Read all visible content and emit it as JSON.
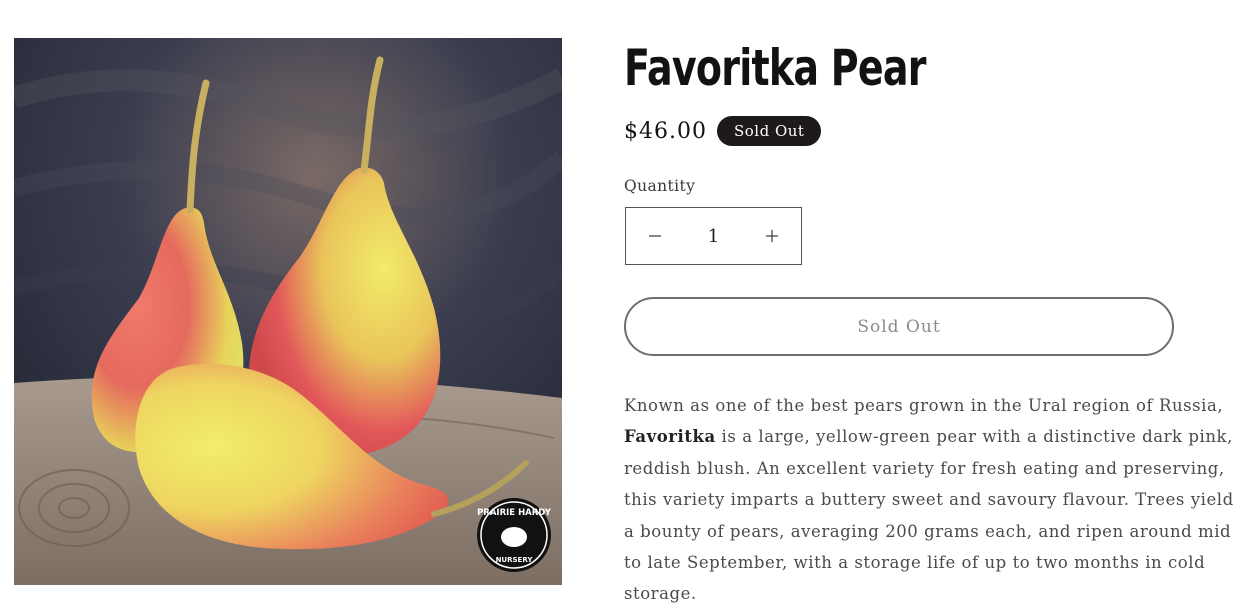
{
  "product": {
    "title": "Favoritka Pear",
    "price": "$46.00",
    "badge": "Sold Out",
    "image_logo_text_top": "PRAIRIE HARDY",
    "image_logo_text_bottom": "NURSERY"
  },
  "quantity": {
    "label": "Quantity",
    "value": "1",
    "decrease_icon": "minus-icon",
    "increase_icon": "plus-icon"
  },
  "buy_button": {
    "label": "Sold Out"
  },
  "description": {
    "part1": "Known as one of the best pears grown in the Ural region of Russia, ",
    "bold": "Favoritka",
    "part2": " is a large, yellow-green pear with a distinctive dark pink, reddish blush. An excellent variety for fresh eating and preserving, this variety imparts a buttery sweet and savoury flavour. Trees yield a bounty of pears, averaging 200 grams each, and ripen around mid to late September, with a storage life of up to two months in cold storage."
  },
  "colors": {
    "badge_bg": "#1f1a1a",
    "text": "#121212",
    "button_border": "#6e6e6e"
  }
}
